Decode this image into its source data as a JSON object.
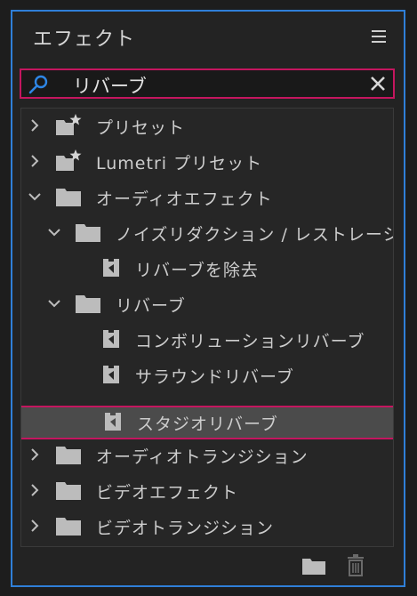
{
  "panel": {
    "title": "エフェクト"
  },
  "search": {
    "value": "リバーブ"
  },
  "tree": [
    {
      "label": "プリセット",
      "expanded": false,
      "icon": "preset-folder-icon"
    },
    {
      "label": "Lumetri プリセット",
      "expanded": false,
      "icon": "preset-folder-icon"
    },
    {
      "label": "オーディオエフェクト",
      "expanded": true,
      "icon": "folder-icon"
    },
    {
      "label": "ノイズリダクション / レストレーション",
      "expanded": true,
      "icon": "folder-icon"
    },
    {
      "label": "リバーブを除去",
      "icon": "audio-effect-icon"
    },
    {
      "label": "リバーブ",
      "expanded": true,
      "icon": "folder-icon"
    },
    {
      "label": "コンボリューションリバーブ",
      "icon": "audio-effect-icon"
    },
    {
      "label": "サラウンドリバーブ",
      "icon": "audio-effect-icon"
    },
    {
      "label": "スタジオリバーブ",
      "icon": "audio-effect-icon",
      "selected": true
    },
    {
      "label": "オーディオトランジション",
      "expanded": false,
      "icon": "folder-icon"
    },
    {
      "label": "ビデオエフェクト",
      "expanded": false,
      "icon": "folder-icon"
    },
    {
      "label": "ビデオトランジション",
      "expanded": false,
      "icon": "folder-icon"
    }
  ]
}
